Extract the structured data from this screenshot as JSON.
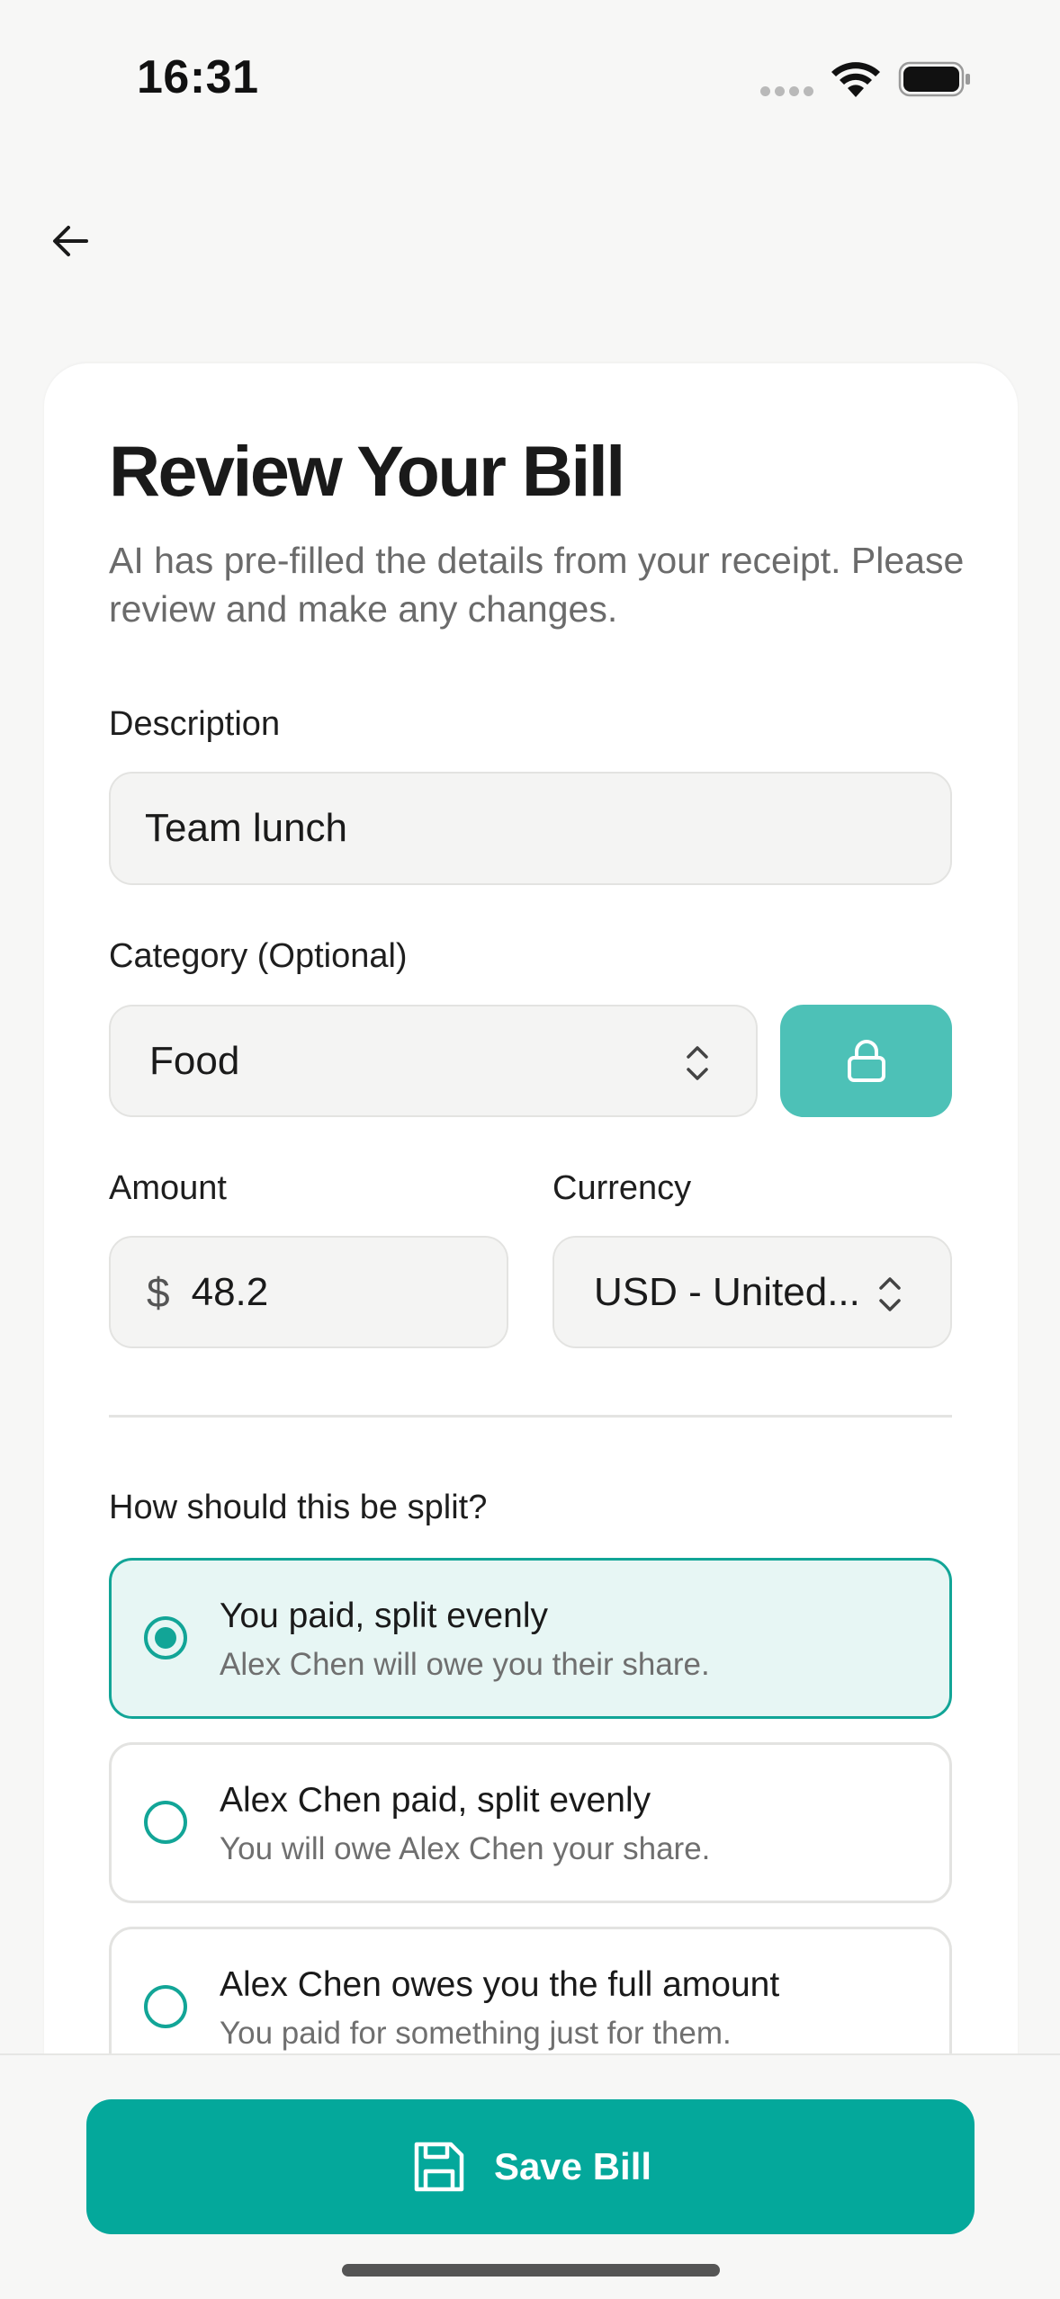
{
  "status_bar": {
    "time": "16:31",
    "signal_icon": "signal-dots-icon",
    "wifi_icon": "wifi-icon",
    "battery_icon": "battery-icon"
  },
  "nav": {
    "back_icon": "arrow-left-icon"
  },
  "header": {
    "title": "Review Your Bill",
    "subtitle": "AI has pre-filled the details from your receipt. Please review and make any changes."
  },
  "form": {
    "description_label": "Description",
    "description_value": "Team lunch",
    "category_label": "Category (Optional)",
    "category_value": "Food",
    "category_lock_icon": "lock-icon",
    "amount_label": "Amount",
    "amount_currency_symbol": "$",
    "amount_value": "48.2",
    "currency_label": "Currency",
    "currency_value": "USD - United..."
  },
  "split": {
    "question": "How should this be split?",
    "options": [
      {
        "title": "You paid, split evenly",
        "subtitle": "Alex Chen will owe you their share.",
        "selected": true
      },
      {
        "title": "Alex Chen paid, split evenly",
        "subtitle": "You will owe Alex Chen your share.",
        "selected": false
      },
      {
        "title": "Alex Chen owes you the full amount",
        "subtitle": "You paid for something just for them.",
        "selected": false
      }
    ]
  },
  "footer": {
    "save_label": "Save Bill",
    "save_icon": "save-icon"
  },
  "colors": {
    "accent": "#04a89b",
    "accent_light": "#4dc1b7",
    "selected_bg": "#e7f6f4"
  }
}
